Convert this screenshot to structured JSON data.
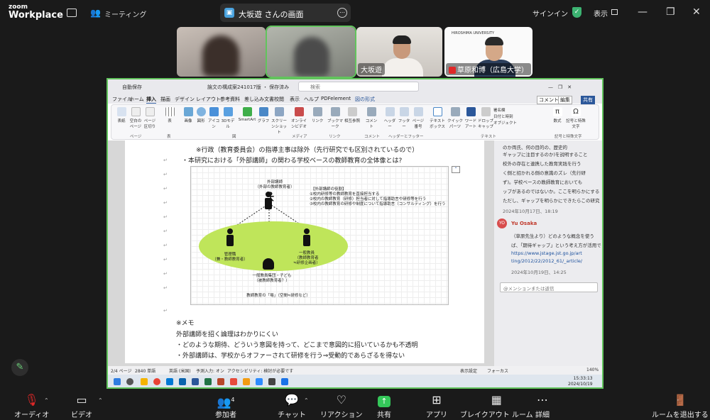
{
  "app": {
    "logo_top": "zoom",
    "logo_bottom": "Workplace",
    "meeting_label": "ミーティング"
  },
  "share_bar": {
    "text": "大坂遊 さんの画面",
    "more": "⋯"
  },
  "top_right": {
    "signin": "サインイン",
    "view": "表示"
  },
  "participants": [
    {
      "name": ""
    },
    {
      "name": ""
    },
    {
      "name": "大坂遊"
    },
    {
      "name": "草原和博（広島大学）",
      "org_logo_text": "HIROSHIMA UNIVERSITY"
    }
  ],
  "word": {
    "title_left": "自動保存",
    "doc_name": "論文の構成案241017版 ・ 保存済み",
    "search": "検索",
    "menu": [
      "ファイル",
      "ホーム",
      "挿入",
      "描画",
      "デザイン",
      "レイアウト",
      "参考資料",
      "差し込み文書",
      "校閲",
      "表示",
      "ヘルプ",
      "PDFelement",
      "図の形式"
    ],
    "active_menu": "挿入",
    "menu_right": [
      "コメント",
      "編集",
      "共有"
    ],
    "ribbon_buttons": [
      "表紙",
      "空白のページ",
      "ページ区切り",
      "表",
      "画像",
      "図形",
      "アイコン",
      "3Dモデル",
      "SmartArt",
      "グラフ",
      "スクリーンショット",
      "オンラインビデオ",
      "リンク",
      "ブックマーク",
      "相互参照",
      "コメント",
      "ヘッダー",
      "フッター",
      "ページ番号",
      "テキストボックス",
      "クイックパーツ",
      "ワードアート",
      "ドロップキャップ",
      "数式",
      "記号と特殊文字"
    ],
    "ribbon_side": [
      "署名欄",
      "日付と時刻",
      "オブジェクト"
    ],
    "ribbon_groups": [
      "ページ",
      "表",
      "図",
      "メディア",
      "リンク",
      "コメント",
      "ヘッダーとフッター",
      "テキスト",
      "記号と特殊文字"
    ],
    "doc_lines": {
      "l1": "※行政（教育委員会）の指導主事は除外（先行研究でも区別されているので）",
      "l2": "・本研究における「外部講師」の関わる学校ベースの教師教育の全体像とは?",
      "memo": "※メモ",
      "m1": "外部講師を招く論理はわかりにくい",
      "m2": "・どのような期待、どういう意図を持って、どこまで意図的に招いているかも不透明",
      "m3": "・外部講師は、学校からオファーされて研修を行う⇒受動的であらざるを得ない"
    },
    "diagram": {
      "ext_title": "外部講師",
      "ext_sub": "（外部の教師教育者）",
      "roles_title": "【外部講師の役割】",
      "roles": [
        "①校内研修等の教師教育を直接担当する",
        "②校内の教師教育（研修）担当者に対して指導助言や研修等を行う",
        "③校内の教師教育の研修や制度について指導助言（コンサルティング）を行う"
      ],
      "mgr": "管理職",
      "mgr_sub": "（兼・教師教育者）",
      "teacher": "一般教員",
      "teacher_sub1": "（教師教育者",
      "teacher_sub2": "≒研修企画者）",
      "group": "一般教員集団・子ども",
      "group_sub": "（被教師教育者？）",
      "place": "教師教育の「場」（空間≒研修など）"
    },
    "comments": {
      "c1_lines": [
        "のか両氏、何の目的の、歴史的",
        "ギャップに注目するのか)を説明すること",
        "校外の存在と連携した教育実践を行う",
        "く側と招かれる側の意識のズレ（先行研",
        "ず)。学校ベースの教師教育においても",
        "ップがあるのではないか。ここを明らかにする",
        "ただし、ギャップを明らかにできたらこの研究"
      ],
      "c1_date": "2024年10月17日、18:19",
      "c2_author": "Yu Osaka",
      "c2_initials": "YO",
      "c2_lines": [
        "（草原先生より）どのような概念を使う",
        "ば、「期待ギャップ」という考え方が活用で",
        "https://www.jstage.jst.go.jp/art",
        "ting/2012/22/2012_61/_article/"
      ],
      "c2_date": "2024年10月19日、14:25",
      "reply": "@メンションまたは返信"
    },
    "status": {
      "page": "2/4 ページ",
      "words": "2840 単語",
      "lang": "英語 (米国)",
      "input": "予測入力: オン",
      "access": "アクセシビリティ: 検討が必要です",
      "focus": "フォーカス",
      "display": "表示設定",
      "zoom": "140%"
    },
    "taskbar_time": "15:33:13",
    "taskbar_date": "2024/10/19"
  },
  "bottom": {
    "audio": "オーディオ",
    "video": "ビデオ",
    "participants": "参加者",
    "participants_count": "4",
    "chat": "チャット",
    "reaction": "リアクション",
    "share": "共有",
    "apps": "アプリ",
    "breakout": "ブレイクアウト ルーム",
    "more": "詳細",
    "leave": "ルームを退出する"
  },
  "colors": {
    "accent_green": "#62c45d",
    "share_green": "#34c759",
    "ellipse": "#bfe55a",
    "mute_red": "#e02828"
  }
}
